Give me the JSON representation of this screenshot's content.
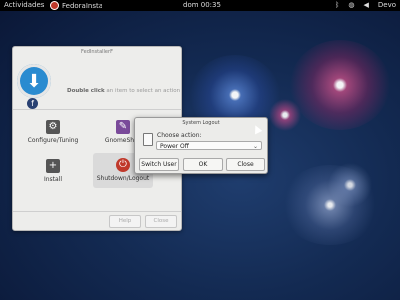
{
  "topbar": {
    "activities": "Actividades",
    "app_name": "FedoraInstallerF",
    "clock": "dom 00:35",
    "user": "Devo"
  },
  "window": {
    "title": "FedInstallerF",
    "hint_bold": "Double click",
    "hint_rest": " an item to select an action",
    "tiles": [
      {
        "label": "Configure/Tuning",
        "icon": "gear-icon"
      },
      {
        "label": "GnomeShell",
        "icon": "gnome-icon"
      },
      {
        "label": "Install",
        "icon": "plus-icon"
      },
      {
        "label": "Shutdown/Logout",
        "icon": "power-icon"
      }
    ],
    "help": "Help",
    "close": "Close"
  },
  "dialog": {
    "title": "System Logout",
    "choose_label": "Choose action:",
    "selected_option": "Power Off",
    "switch_user": "Switch User",
    "ok": "OK",
    "close": "Close"
  }
}
